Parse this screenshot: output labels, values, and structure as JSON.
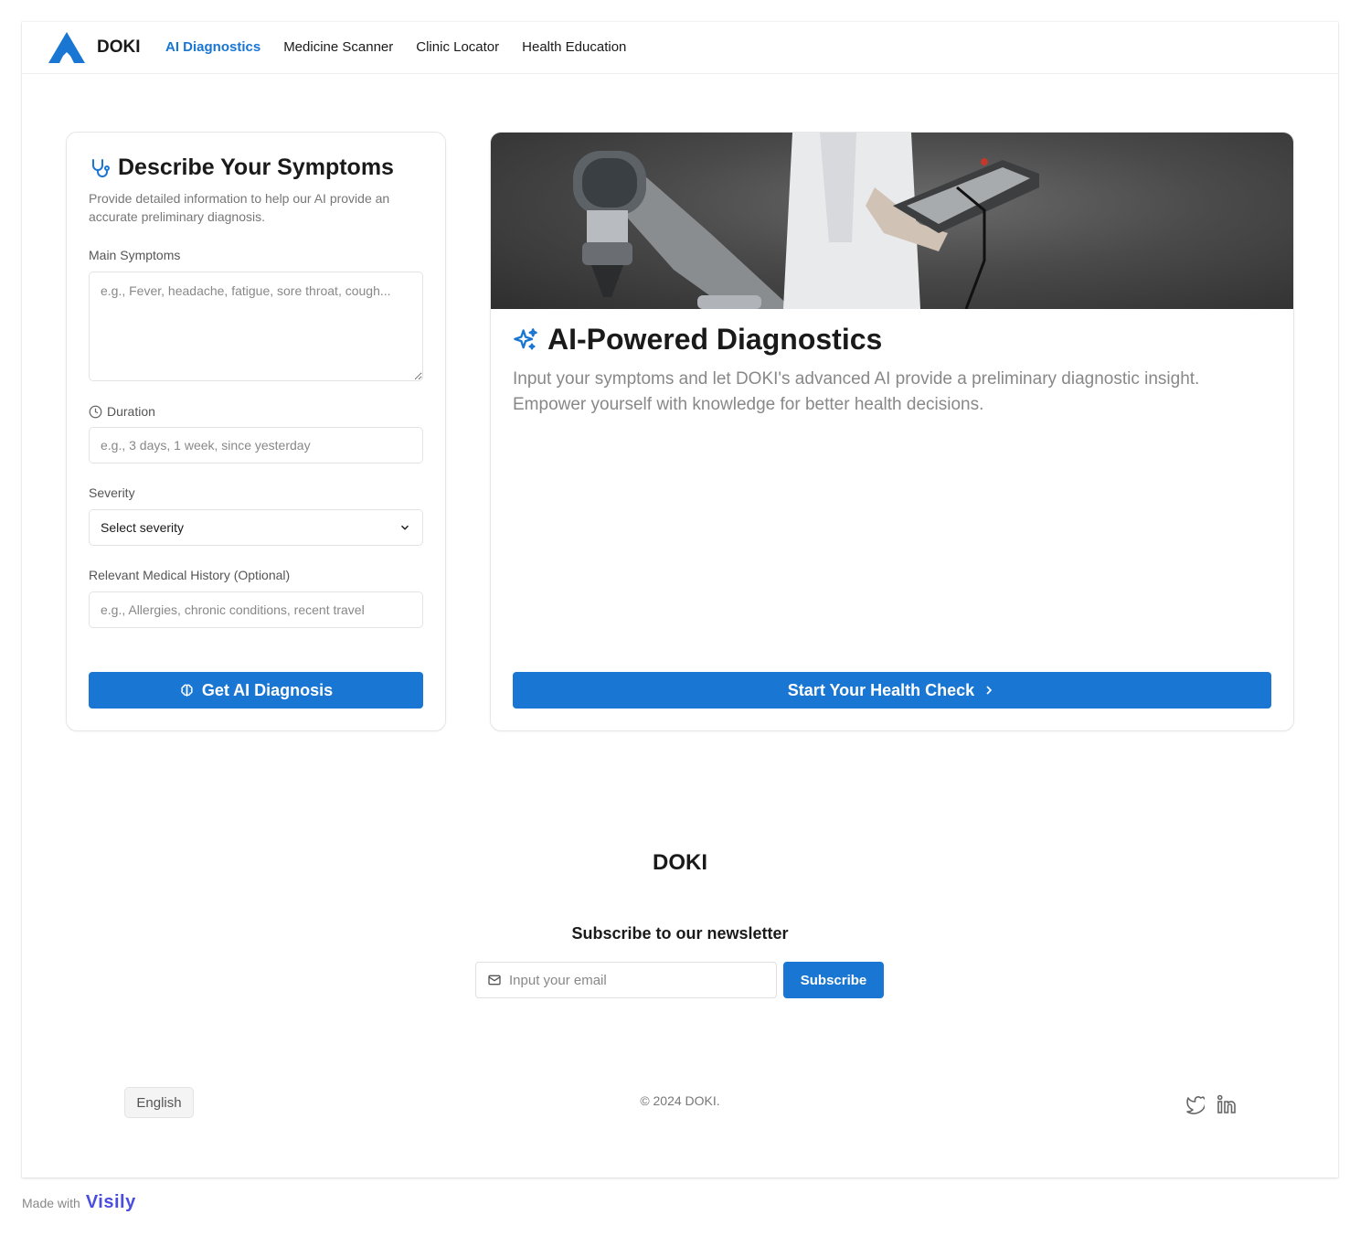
{
  "header": {
    "brand": "DOKI",
    "nav": [
      {
        "label": "AI Diagnostics",
        "active": true
      },
      {
        "label": "Medicine Scanner",
        "active": false
      },
      {
        "label": "Clinic Locator",
        "active": false
      },
      {
        "label": "Health Education",
        "active": false
      }
    ]
  },
  "symptom_form": {
    "title": "Describe Your Symptoms",
    "description": "Provide detailed information to help our AI provide an accurate preliminary diagnosis.",
    "main_symptoms_label": "Main Symptoms",
    "main_symptoms_placeholder": "e.g., Fever, headache, fatigue, sore throat, cough...",
    "duration_label": "Duration",
    "duration_placeholder": "e.g., 3 days, 1 week, since yesterday",
    "severity_label": "Severity",
    "severity_value": "Select severity",
    "history_label": "Relevant Medical History (Optional)",
    "history_placeholder": "e.g., Allergies, chronic conditions, recent travel",
    "submit_label": "Get AI Diagnosis"
  },
  "info_card": {
    "title": "AI-Powered Diagnostics",
    "description": "Input your symptoms and let DOKI's advanced AI provide a preliminary diagnostic insight. Empower yourself with knowledge for better health decisions.",
    "cta_label": "Start Your Health Check"
  },
  "footer": {
    "brand": "DOKI",
    "newsletter_title": "Subscribe to our newsletter",
    "email_placeholder": "Input your email",
    "subscribe_label": "Subscribe",
    "language": "English",
    "copyright": "© 2024 DOKI.",
    "social": [
      "twitter-icon",
      "linkedin-icon"
    ]
  },
  "made_with": {
    "text": "Made with",
    "brand": "Visily"
  },
  "colors": {
    "accent": "#1976d2",
    "text": "#1a1a1a",
    "muted": "#888888"
  }
}
